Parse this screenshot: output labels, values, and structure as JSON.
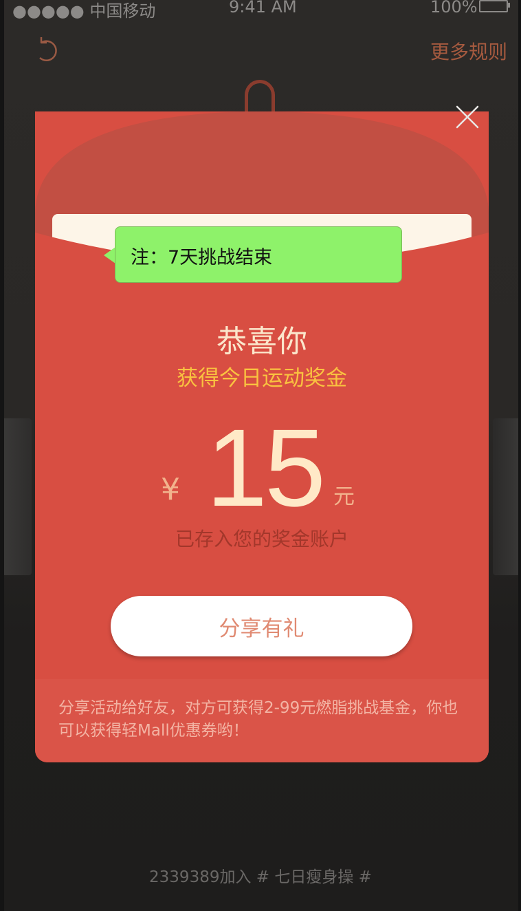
{
  "status_bar": {
    "carrier": "●●●●● 中国移动",
    "time": "9:41 AM",
    "battery": "100%"
  },
  "header": {
    "back_icon": "back-arrow-icon",
    "more_rules": "更多规则",
    "close_icon": "close-icon"
  },
  "note": {
    "text": "注：7天挑战结束"
  },
  "red_packet": {
    "congrats": "恭喜你",
    "subtitle": "获得今日运动奖金",
    "currency_symbol": "¥",
    "amount": "15",
    "unit": "元",
    "deposit_text": "已存入您的奖金账户",
    "share_button": "分享有礼",
    "info_text": "分享活动给好友，对方可获得2-99元燃脂挑战基金，你也可以获得轻Mall优惠券哟！"
  },
  "footer": {
    "text": "2339389加入 # 七日瘦身操 #"
  },
  "colors": {
    "envelope_red": "#d84e42",
    "flap_red": "#c24f43",
    "note_green": "#8ef26a",
    "subtitle_gold": "#f9c240",
    "amount_cream": "#ffe9c7",
    "accent_orange": "#a65a3f"
  }
}
